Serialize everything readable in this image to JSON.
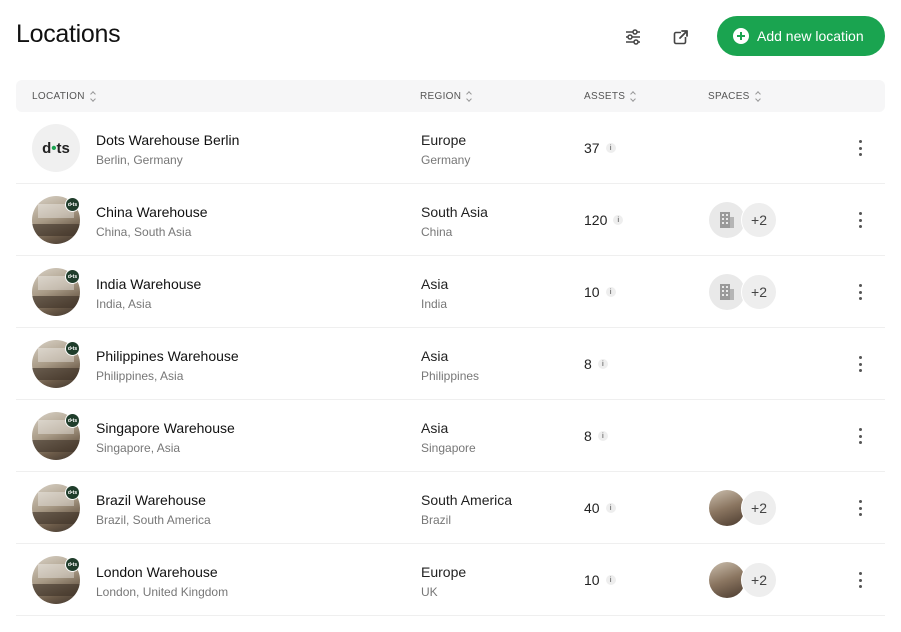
{
  "page": {
    "title": "Locations"
  },
  "toolbar": {
    "filter_icon": "sliders-icon",
    "export_icon": "external-link-icon",
    "add_label": "Add new location",
    "accent": "#1aa450"
  },
  "table": {
    "columns": [
      "LOCATION",
      "REGION",
      "ASSETS",
      "SPACES"
    ],
    "rows": [
      {
        "name": "Dots Warehouse Berlin",
        "sub": "Berlin, Germany",
        "region": "Europe",
        "region_sub": "Germany",
        "assets": "37",
        "avatar": "dots-logo",
        "spaces_thumb": null,
        "spaces_more": null
      },
      {
        "name": "China Warehouse",
        "sub": "China, South Asia",
        "region": "South Asia",
        "region_sub": "China",
        "assets": "120",
        "avatar": "photo",
        "spaces_thumb": "building-icon",
        "spaces_more": "+2"
      },
      {
        "name": "India Warehouse",
        "sub": "India, Asia",
        "region": "Asia",
        "region_sub": "India",
        "assets": "10",
        "avatar": "photo",
        "spaces_thumb": "building-icon",
        "spaces_more": "+2"
      },
      {
        "name": "Philippines Warehouse",
        "sub": "Philippines, Asia",
        "region": "Asia",
        "region_sub": "Philippines",
        "assets": "8",
        "avatar": "photo",
        "spaces_thumb": null,
        "spaces_more": null
      },
      {
        "name": "Singapore Warehouse",
        "sub": "Singapore, Asia",
        "region": "Asia",
        "region_sub": "Singapore",
        "assets": "8",
        "avatar": "photo",
        "spaces_thumb": null,
        "spaces_more": null
      },
      {
        "name": "Brazil Warehouse",
        "sub": "Brazil, South America",
        "region": "South America",
        "region_sub": "Brazil",
        "assets": "40",
        "avatar": "photo",
        "spaces_thumb": "photo",
        "spaces_more": "+2"
      },
      {
        "name": "London Warehouse",
        "sub": "London, United Kingdom",
        "region": "Europe",
        "region_sub": "UK",
        "assets": "10",
        "avatar": "photo",
        "spaces_thumb": "photo",
        "spaces_more": "+2"
      }
    ]
  },
  "logo_text": {
    "left": "d",
    "dot": "•",
    "right": "ts"
  }
}
